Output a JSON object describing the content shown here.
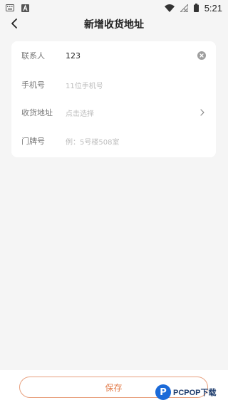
{
  "status_bar": {
    "time": "5:21",
    "icons_left": [
      "keyboard-icon",
      "a-icon"
    ],
    "icons_right": [
      "wifi-icon",
      "no-signal-icon",
      "battery-icon"
    ]
  },
  "header": {
    "title": "新增收货地址",
    "back_icon": "chevron-left-icon"
  },
  "form": {
    "contact": {
      "label": "联系人",
      "value": "123",
      "clear_icon": "clear-icon"
    },
    "phone": {
      "label": "手机号",
      "placeholder": "11位手机号"
    },
    "address": {
      "label": "收货地址",
      "placeholder": "点击选择",
      "chevron": "chevron-right-icon"
    },
    "door": {
      "label": "门牌号",
      "placeholder": "例：5号楼508室"
    }
  },
  "footer": {
    "save_label": "保存"
  },
  "watermark": {
    "letter": "P",
    "text": "PCPOP下载"
  },
  "colors": {
    "accent": "#e27b4a",
    "accent_border": "#e8a07e",
    "background": "#f5f5f5",
    "card": "#ffffff"
  }
}
